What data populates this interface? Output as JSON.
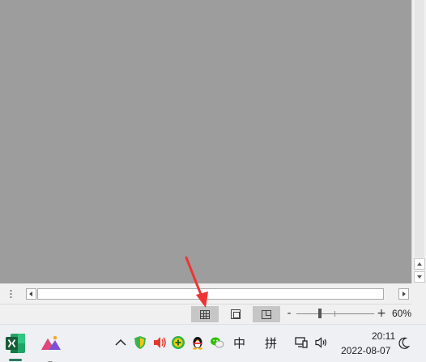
{
  "statusbar": {
    "zoom_level": "60%",
    "zoom_minus": "-",
    "zoom_plus": "+",
    "zoom_fraction": 0.3,
    "views": [
      {
        "name": "normal-view",
        "icon": "grid-icon",
        "active": true
      },
      {
        "name": "page-layout-view",
        "icon": "page-layout-icon",
        "active": false
      },
      {
        "name": "page-break-preview",
        "icon": "page-break-icon",
        "active": true
      }
    ]
  },
  "annotation": {
    "color": "#ee3333",
    "icon": "red-arrow-icon"
  },
  "taskbar": {
    "apps": [
      {
        "name": "excel",
        "icon": "excel-icon",
        "color": "#1f7246"
      },
      {
        "name": "second-app",
        "icon": "mountain-app-icon",
        "color": "#7b4fd6"
      }
    ],
    "tray": {
      "chevron": "^",
      "ime_language": "中",
      "ime_mode": "拼",
      "clock_time": "20:11",
      "clock_date": "2022-08-07"
    }
  },
  "colors": {
    "workspace": "#9d9d9d",
    "chrome": "#f0f0f0",
    "active_view": "#c6c6c6"
  }
}
